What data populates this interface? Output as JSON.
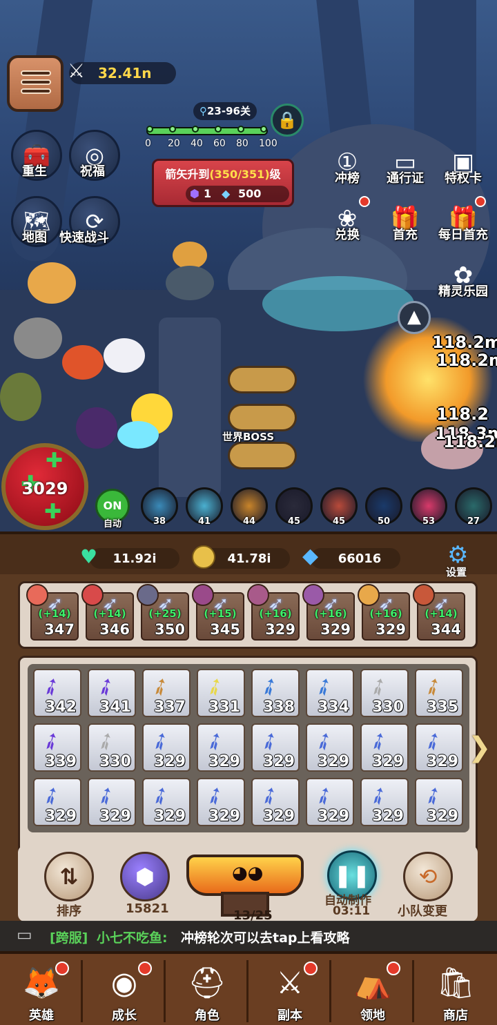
{
  "top": {
    "power": "32.41n",
    "stage": "23-96关",
    "progress_ticks": [
      "0",
      "20",
      "40",
      "60",
      "80",
      "100"
    ],
    "progress": 1.0,
    "upgrade_banner": {
      "title_prefix": "箭矢升到",
      "title_highlight": "(350/351)",
      "title_suffix": "级",
      "cost_a": "1",
      "cost_b": "500"
    }
  },
  "left_buttons": [
    {
      "label": "重生",
      "icon": "chest-icon"
    },
    {
      "label": "祝福",
      "icon": "blessing-icon"
    },
    {
      "label": "地图",
      "icon": "map-icon"
    },
    {
      "label": "快速战斗",
      "icon": "fast-battle-icon"
    }
  ],
  "right_buttons": [
    {
      "label": "冲榜",
      "icon": "ranking-icon",
      "dot": false
    },
    {
      "label": "通行证",
      "icon": "pass-icon",
      "dot": false
    },
    {
      "label": "特权卡",
      "icon": "privilege-card-icon",
      "dot": false
    },
    {
      "label": "兑换",
      "icon": "exchange-icon",
      "dot": true
    },
    {
      "label": "首充",
      "icon": "first-charge-icon",
      "dot": false
    },
    {
      "label": "每日首充",
      "icon": "daily-charge-icon",
      "dot": true
    },
    {
      "label": "精灵乐园",
      "icon": "spirit-park-icon",
      "dot": false
    }
  ],
  "battle": {
    "world_boss": "世界BOSS",
    "hp": "3029",
    "auto_on": "ON",
    "auto_label": "自动",
    "damage": [
      "118.2m",
      "118.2m",
      "118.2",
      "118.3m",
      "118.2m"
    ]
  },
  "hero_bar": [
    {
      "level": "38"
    },
    {
      "level": "41"
    },
    {
      "level": "44"
    },
    {
      "level": "45"
    },
    {
      "level": "45"
    },
    {
      "level": "50"
    },
    {
      "level": "53"
    },
    {
      "level": "27"
    }
  ],
  "currencies": {
    "hearts": "11.92i",
    "coins": "41.78i",
    "diamonds": "66016",
    "settings": "设置"
  },
  "equipped": [
    {
      "bonus": "(+14)",
      "level": "347"
    },
    {
      "bonus": "(+14)",
      "level": "346"
    },
    {
      "bonus": "(+25)",
      "level": "350"
    },
    {
      "bonus": "(+15)",
      "level": "345"
    },
    {
      "bonus": "(+16)",
      "level": "329"
    },
    {
      "bonus": "(+16)",
      "level": "329"
    },
    {
      "bonus": "(+16)",
      "level": "329"
    },
    {
      "bonus": "(+14)",
      "level": "344"
    }
  ],
  "inventory": [
    "342",
    "341",
    "337",
    "331",
    "338",
    "334",
    "330",
    "335",
    "339",
    "330",
    "329",
    "329",
    "329",
    "329",
    "329",
    "329",
    "329",
    "329",
    "329",
    "329",
    "329",
    "329",
    "329",
    "329"
  ],
  "actions": {
    "sort": "排序",
    "energy": "15821",
    "anvil": "13/25",
    "auto_make": "自动制作",
    "auto_timer": "03:11",
    "team_change": "小队变更"
  },
  "chat": {
    "channel": "[跨服]",
    "user": "小七不吃鱼:",
    "message": "冲榜轮次可以去tap上看攻略"
  },
  "nav": [
    {
      "label": "英雄",
      "icon": "hero-icon",
      "dot": true
    },
    {
      "label": "成长",
      "icon": "growth-icon",
      "dot": true
    },
    {
      "label": "角色",
      "icon": "character-icon",
      "dot": false
    },
    {
      "label": "副本",
      "icon": "dungeon-icon",
      "dot": true
    },
    {
      "label": "领地",
      "icon": "territory-icon",
      "dot": true
    },
    {
      "label": "商店",
      "icon": "shop-icon",
      "dot": false
    }
  ]
}
